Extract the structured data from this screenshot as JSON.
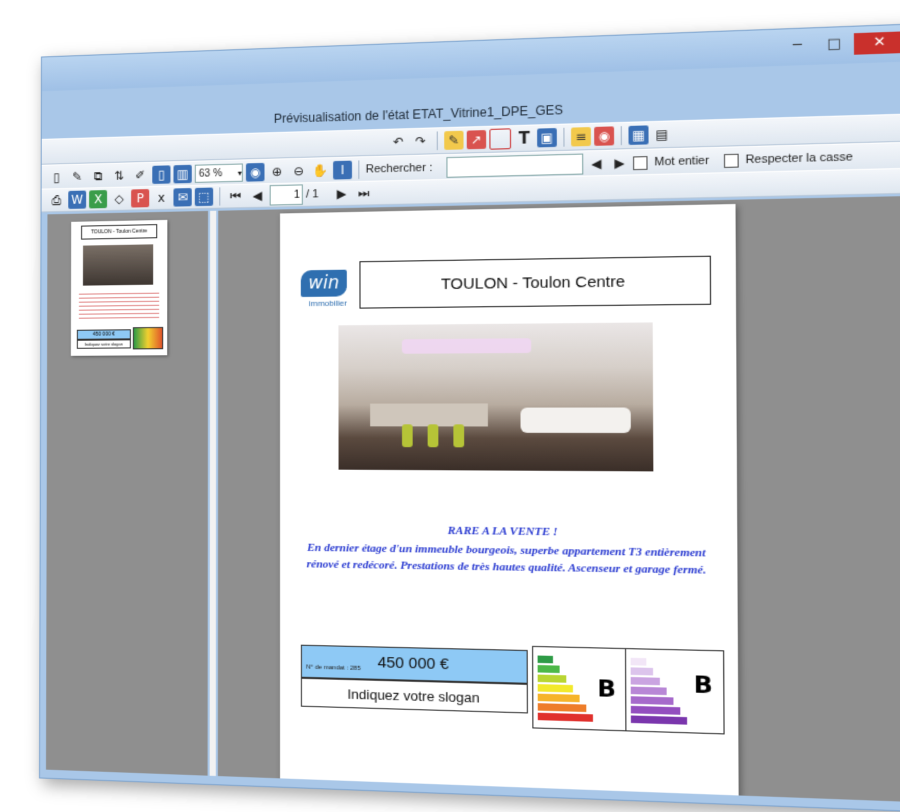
{
  "window": {
    "title": "Prévisualisation de l'état ETAT_Vitrine1_DPE_GES",
    "buttons": {
      "minimize": "─",
      "maximize": "□",
      "close": "✕"
    }
  },
  "toolbar": {
    "zoom_value": "63 %",
    "search_label": "Rechercher :",
    "search_value": "",
    "page_current": "1",
    "page_total": "/ 1",
    "option_mot_entier": "Mot entier",
    "option_respecter_casse": "Respecter la casse"
  },
  "icons": {
    "print": "print-icon",
    "edit": "edit-icon",
    "copy": "copy-icon",
    "pen": "pen-icon",
    "arrow": "arrow-icon",
    "rect": "rectangle-icon",
    "text": "text-tool-icon",
    "image": "image-icon",
    "color": "color-icon"
  },
  "thumbnail": {
    "title": "TOULON - Toulon Centre",
    "price": "450 000 €",
    "slogan": "Indiquez votre slogan"
  },
  "document": {
    "logo_main": "win",
    "logo_sub": "immobilier",
    "heading": "TOULON - Toulon Centre",
    "description_lead": "RARE A LA VENTE !",
    "description_body": "En dernier étage d'un immeuble bourgeois, superbe appartement T3 entièrement rénové et redécoré. Prestations de très hautes qualité. Ascenseur et garage fermé.",
    "price": "450 000 €",
    "price_label": "N° de mandat : 285",
    "slogan": "Indiquez votre slogan",
    "dpe_grade": "B",
    "ges_grade": "B"
  },
  "colors": {
    "window_frame": "#a9c7e8",
    "pane_gray": "#8f8f8f",
    "price_blue": "#8ec9f5",
    "text_blue": "#2a3bd1",
    "logo_blue": "#2f6fb0"
  }
}
